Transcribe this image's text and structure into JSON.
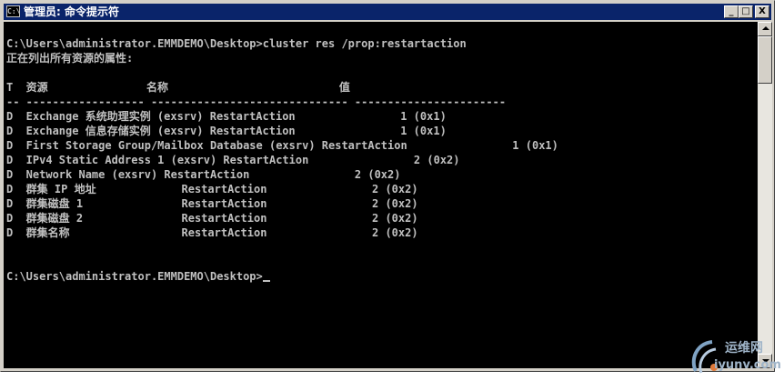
{
  "window": {
    "title": "管理员: 命令提示符",
    "icon_label": "C:\\",
    "minimize_glyph": "_",
    "restore_glyph": "□",
    "close_glyph": "X"
  },
  "console": {
    "lines": [
      "",
      "C:\\Users\\administrator.EMMDEMO\\Desktop>cluster res /prop:restartaction",
      "正在列出所有资源的属性:",
      "",
      "T  资源               名称                          值",
      "-- ------------------ ------------------------------ -----------------------",
      "D  Exchange 系统助理实例 (exsrv) RestartAction                1 (0x1)",
      "D  Exchange 信息存储实例 (exsrv) RestartAction                1 (0x1)",
      "D  First Storage Group/Mailbox Database (exsrv) RestartAction                1 (0x1)",
      "D  IPv4 Static Address 1 (exsrv) RestartAction                2 (0x2)",
      "D  Network Name (exsrv) RestartAction                2 (0x2)",
      "D  群集 IP 地址             RestartAction                2 (0x2)",
      "D  群集磁盘 1               RestartAction                2 (0x2)",
      "D  群集磁盘 2               RestartAction                2 (0x2)",
      "D  群集名称                 RestartAction                2 (0x2)",
      "",
      "",
      "C:\\Users\\administrator.EMMDEMO\\Desktop>"
    ]
  },
  "watermark": {
    "line1": "运维网",
    "line2": "iyunv.com"
  },
  "colors": {
    "titlebar": "#0a246a",
    "console_bg": "#000000",
    "console_fg": "#c0c0c0",
    "chrome": "#d4d0c8"
  }
}
